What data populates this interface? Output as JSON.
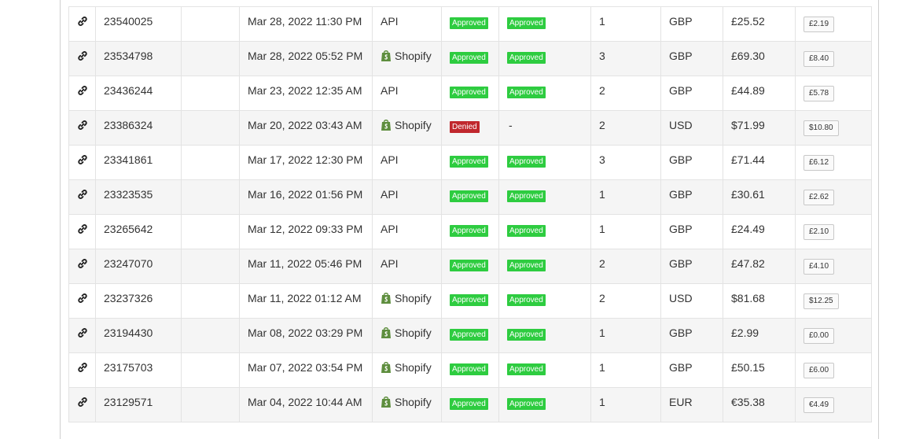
{
  "rows": [
    {
      "id": "23540025",
      "date": "Mar 28, 2022 11:30 PM",
      "platform": "API",
      "platform_icon": "",
      "status1": "Approved",
      "status2": "Approved",
      "qty": "1",
      "currency": "GBP",
      "total": "£25.52",
      "fee": "£2.19"
    },
    {
      "id": "23534798",
      "date": "Mar 28, 2022 05:52 PM",
      "platform": "Shopify",
      "platform_icon": "shopify-bag-icon",
      "status1": "Approved",
      "status2": "Approved",
      "qty": "3",
      "currency": "GBP",
      "total": "£69.30",
      "fee": "£8.40"
    },
    {
      "id": "23436244",
      "date": "Mar 23, 2022 12:35 AM",
      "platform": "API",
      "platform_icon": "",
      "status1": "Approved",
      "status2": "Approved",
      "qty": "2",
      "currency": "GBP",
      "total": "£44.89",
      "fee": "£5.78"
    },
    {
      "id": "23386324",
      "date": "Mar 20, 2022 03:43 AM",
      "platform": "Shopify",
      "platform_icon": "shopify-bag-icon",
      "status1": "Denied",
      "status2": "-",
      "qty": "2",
      "currency": "USD",
      "total": "$71.99",
      "fee": "$10.80"
    },
    {
      "id": "23341861",
      "date": "Mar 17, 2022 12:30 PM",
      "platform": "API",
      "platform_icon": "",
      "status1": "Approved",
      "status2": "Approved",
      "qty": "3",
      "currency": "GBP",
      "total": "£71.44",
      "fee": "£6.12"
    },
    {
      "id": "23323535",
      "date": "Mar 16, 2022 01:56 PM",
      "platform": "API",
      "platform_icon": "",
      "status1": "Approved",
      "status2": "Approved",
      "qty": "1",
      "currency": "GBP",
      "total": "£30.61",
      "fee": "£2.62"
    },
    {
      "id": "23265642",
      "date": "Mar 12, 2022 09:33 PM",
      "platform": "API",
      "platform_icon": "",
      "status1": "Approved",
      "status2": "Approved",
      "qty": "1",
      "currency": "GBP",
      "total": "£24.49",
      "fee": "£2.10"
    },
    {
      "id": "23247070",
      "date": "Mar 11, 2022 05:46 PM",
      "platform": "API",
      "platform_icon": "",
      "status1": "Approved",
      "status2": "Approved",
      "qty": "2",
      "currency": "GBP",
      "total": "£47.82",
      "fee": "£4.10"
    },
    {
      "id": "23237326",
      "date": "Mar 11, 2022 01:12 AM",
      "platform": "Shopify",
      "platform_icon": "shopify-bag-icon",
      "status1": "Approved",
      "status2": "Approved",
      "qty": "2",
      "currency": "USD",
      "total": "$81.68",
      "fee": "$12.25"
    },
    {
      "id": "23194430",
      "date": "Mar 08, 2022 03:29 PM",
      "platform": "Shopify",
      "platform_icon": "shopify-bag-icon",
      "status1": "Approved",
      "status2": "Approved",
      "qty": "1",
      "currency": "GBP",
      "total": "£2.99",
      "fee": "£0.00"
    },
    {
      "id": "23175703",
      "date": "Mar 07, 2022 03:54 PM",
      "platform": "Shopify",
      "platform_icon": "shopify-bag-icon",
      "status1": "Approved",
      "status2": "Approved",
      "qty": "1",
      "currency": "GBP",
      "total": "£50.15",
      "fee": "£6.00"
    },
    {
      "id": "23129571",
      "date": "Mar 04, 2022 10:44 AM",
      "platform": "Shopify",
      "platform_icon": "shopify-bag-icon",
      "status1": "Approved",
      "status2": "Approved",
      "qty": "1",
      "currency": "EUR",
      "total": "€35.38",
      "fee": "€4.49"
    }
  ],
  "colors": {
    "approved": "#2ecc40",
    "denied": "#c0272d",
    "shopify": "#5e8e3e"
  },
  "icons": {
    "row_link": "link-icon",
    "shopify": "shopify-bag-icon"
  }
}
